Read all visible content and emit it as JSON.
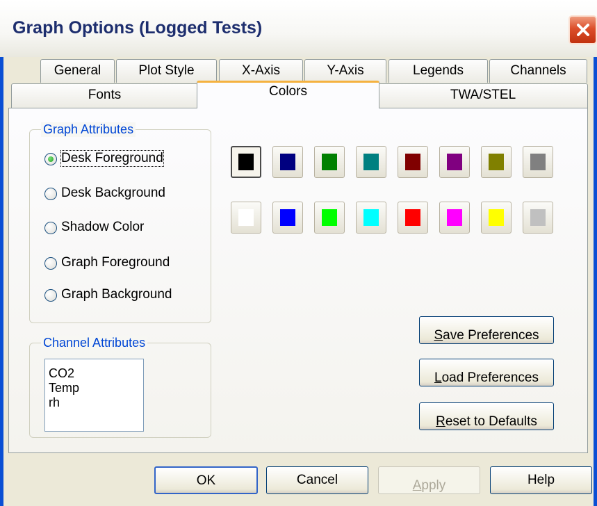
{
  "window": {
    "title": "Graph Options (Logged Tests)",
    "close_icon": "close-icon"
  },
  "tabs_row1": [
    {
      "label": "General"
    },
    {
      "label": "Plot Style"
    },
    {
      "label": "X-Axis"
    },
    {
      "label": "Y-Axis"
    },
    {
      "label": "Legends"
    },
    {
      "label": "Channels"
    }
  ],
  "tabs_row2": [
    {
      "label": "Fonts"
    },
    {
      "label": "Colors",
      "active": true
    },
    {
      "label": "TWA/STEL"
    }
  ],
  "graph_attributes": {
    "label": "Graph Attributes",
    "options": [
      {
        "label": "Desk Foreground",
        "checked": true
      },
      {
        "label": "Desk Background",
        "checked": false
      },
      {
        "label": "Shadow Color",
        "checked": false
      },
      {
        "label": "Graph Foreground",
        "checked": false
      },
      {
        "label": "Graph Background",
        "checked": false
      }
    ]
  },
  "color_palette": {
    "selected_index": 0,
    "colors": [
      "#000000",
      "#000080",
      "#008000",
      "#008080",
      "#800000",
      "#800080",
      "#808000",
      "#808080",
      "#ffffff",
      "#0000ff",
      "#00ff00",
      "#00ffff",
      "#ff0000",
      "#ff00ff",
      "#ffff00",
      "#c0c0c0"
    ]
  },
  "channel_attributes": {
    "label": "Channel Attributes",
    "items": [
      "CO2",
      "Temp",
      "rh"
    ]
  },
  "buttons": {
    "save_first": "S",
    "save_rest": "ave Preferences",
    "load_first": "L",
    "load_rest": "oad Preferences",
    "reset_first": "R",
    "reset_rest": "eset to Defaults",
    "ok": "OK",
    "cancel": "Cancel",
    "apply_first": "A",
    "apply_rest": "pply",
    "help": "Help"
  }
}
